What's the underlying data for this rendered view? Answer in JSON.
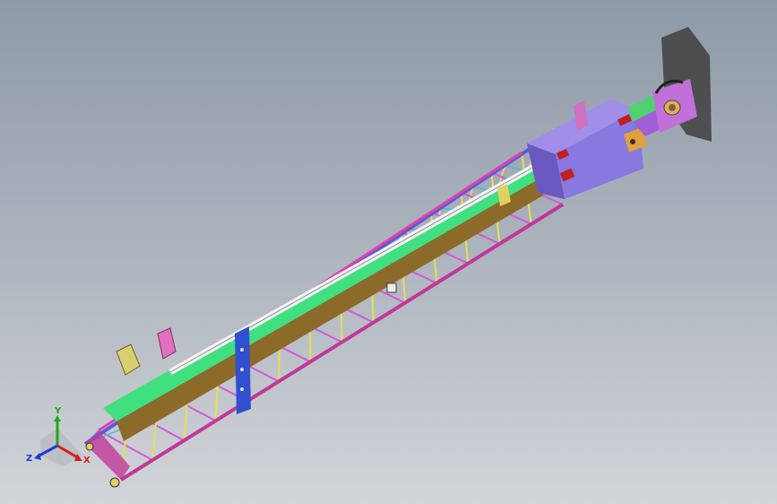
{
  "viewport": {
    "background_top": "#8f9aa8",
    "background_bottom": "#d2d5d9"
  },
  "triad": {
    "x_label": "X",
    "y_label": "Y",
    "z_label": "Z",
    "x_color": "#d81e1e",
    "y_color": "#1ea81e",
    "z_color": "#1e3cd8"
  },
  "model": {
    "name_icon": "lattice-boom-3d-model",
    "colors": {
      "top_chord": "#5a5ad6",
      "bottom_chord": "#c0389a",
      "side_chord": "#e040b0",
      "inner_beam_top": "#40e080",
      "inner_beam_side": "#8c6a2a",
      "highlight_rail": "#f4f4f4",
      "lacing_a": "#e8e050",
      "lacing_b": "#d05ad8",
      "lacing_c": "#40c0d0",
      "head_box": "#8878e0",
      "head_box_side": "#6a58c0",
      "tip_bracket": "#c070d8",
      "shadow_plate": "#404040",
      "post": "#3050d0",
      "lug": "#e070c0"
    }
  }
}
